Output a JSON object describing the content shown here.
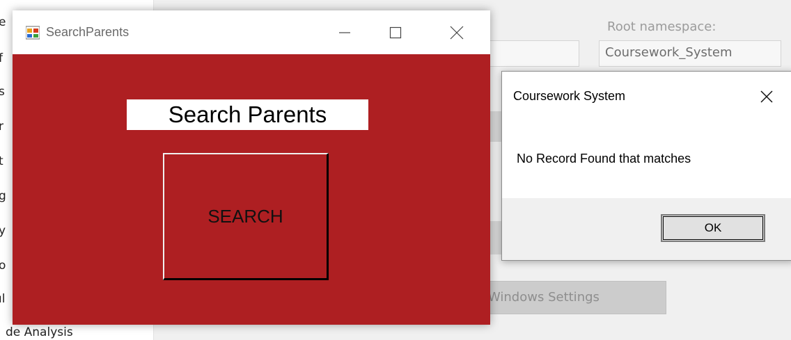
{
  "background": {
    "nav_fragments": [
      "e",
      "f",
      "s",
      "r",
      "t",
      "g",
      "y",
      "o",
      "ıl",
      "de Analysis"
    ],
    "root_namespace_label": "Root namespace:",
    "root_namespace_value": "Coursework_System",
    "windows_settings_label": "Windows Settings",
    "partial_glyph": "t"
  },
  "search_window": {
    "title": "SearchParents",
    "heading": "Search Parents",
    "search_button": "SEARCH",
    "background_color": "#ae1f22"
  },
  "message_box": {
    "title": "Coursework System",
    "message": "No Record Found that matches",
    "ok_label": "OK"
  },
  "icons": {
    "minimize": "minimize-icon",
    "maximize": "maximize-icon",
    "close": "close-icon",
    "app": "app-window-icon"
  }
}
